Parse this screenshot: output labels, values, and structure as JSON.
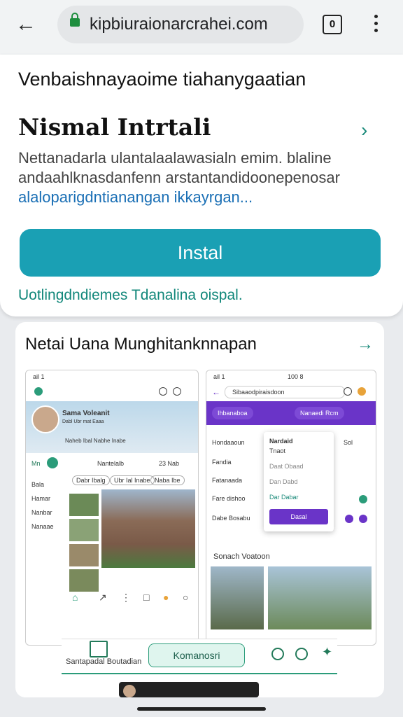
{
  "browser": {
    "url": "kipbiuraionarcrahei.com",
    "tab_count": "0"
  },
  "install_card": {
    "title": "Venbaishnayaoime tiahanygaatian",
    "app_name": "Nismal Intrtali",
    "description_lines": [
      "Nettanadarla ulantalaalawasialn emim. blaline",
      "andaahlknasdanfenn arstantandidoonepenosar"
    ],
    "description_link": "alaloparigdntianangan ikkayrgan...",
    "install_label": "Instal",
    "note": "Uotlingdndiemes Tdanalina oispal."
  },
  "preview_card": {
    "title": "Netai Uana Munghitanknnapan",
    "phone1": {
      "status": "ail 1",
      "profile_name": "Sama Voleanit",
      "profile_sub": "Dabl Ubr mat Eaaa",
      "banner_text": "Naheb Ibal Nabhe Inabe",
      "tab_label": "Nantelalb",
      "count_label": "23 Nab",
      "chip1": "Dabr Ibalg",
      "chip2": "Ubr Ial Inabe",
      "chip3": "Naba Ibe",
      "side_items": [
        "Bala",
        "Hamar",
        "Nanbar",
        "Nanaae"
      ]
    },
    "phone2": {
      "status": "ail 1",
      "time": "100 8",
      "search": "Sibaaodpiraisdoon",
      "pill1": "Ihbanaboa",
      "pill2": "Nanaedi Rcm",
      "list": [
        "Hondaaoun",
        "Fandia",
        "Fatanaada",
        "Fare dishoo",
        "Dabe Bosabu"
      ],
      "popup_title": "Nardaid",
      "popup_sub": "Tnaot",
      "popup_rows": [
        "Daat Obaad",
        "Dan Dabd",
        "Dar Dabar"
      ],
      "popup_btn": "Dasal",
      "side_val": "Sol",
      "section_title": "Sonach Voatoon"
    },
    "bottom": {
      "label": "Santapadal Boutadian",
      "button": "Komanosri"
    }
  },
  "colors": {
    "install_button": "#1aa0b4",
    "accent_green": "#11877a",
    "purple": "#6a34c8"
  }
}
